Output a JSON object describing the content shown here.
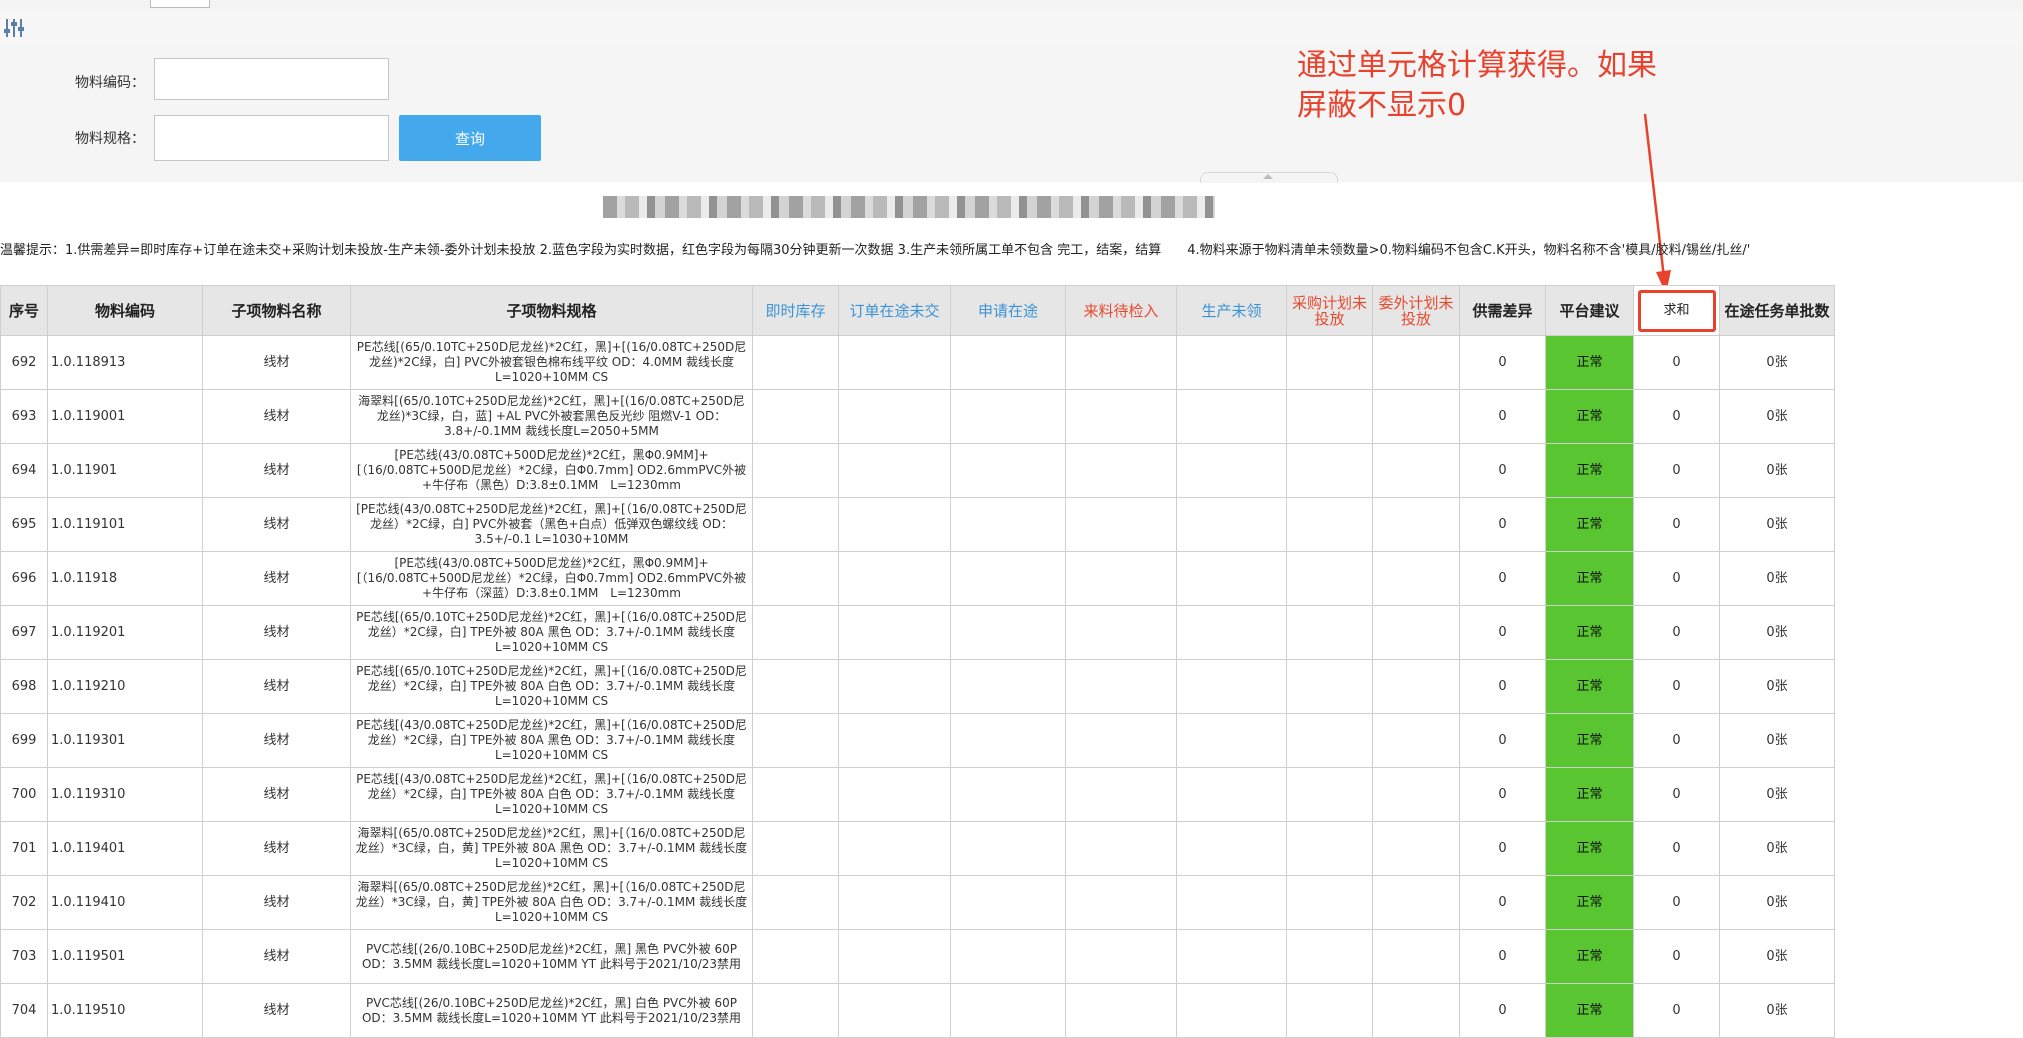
{
  "filter": {
    "code_label": "物料编码：",
    "spec_label": "物料规格：",
    "code_value": "",
    "spec_value": "",
    "query_button": "查询"
  },
  "annotation": {
    "line1": "通过单元格计算获得。如果",
    "line2": "屏蔽不显示0",
    "color": "#e8412c"
  },
  "tip": "温馨提示：1.供需差异=即时库存+订单在途未交+采购计划未投放-生产未领-委外计划未投放 2.蓝色字段为实时数据，红色字段为每隔30分钟更新一次数据 3.生产未领所属工单不包含 完工，结案，结算　　4.物料来源于物料清单未领数量>0.物料编码不包含C.K开头，物料名称不含'模具/胶料/锡丝/扎丝/'",
  "table": {
    "headers": {
      "seq": "序号",
      "code": "物料编码",
      "name": "子项物料名称",
      "spec": "子项物料规格",
      "stock": "即时库存",
      "order_transit": "订单在途未交",
      "apply_transit": "申请在途",
      "incoming": "来料待检入",
      "prod_unclaimed": "生产未领",
      "purchase_plan": "采购计划未投放",
      "outsource_plan": "委外计划未投放",
      "diff": "供需差异",
      "advice": "平台建议",
      "sum": "求和",
      "batches": "在途任务单批数"
    },
    "rows": [
      {
        "seq": "692",
        "code": "1.0.118913",
        "name": "线材",
        "spec": "PE芯线[(65/0.10TC+250D尼龙丝)*2C红，黑]+[(16/0.08TC+250D尼龙丝)*2C绿，白] PVC外被套银色棉布线平纹 OD：4.0MM 裁线长度L=1020+10MM CS",
        "diff": "0",
        "advice": "正常",
        "sum": "0",
        "batches": "0张"
      },
      {
        "seq": "693",
        "code": "1.0.119001",
        "name": "线材",
        "spec": "海翠料[(65/0.10TC+250D尼龙丝)*2C红，黑]+[(16/0.08TC+250D尼龙丝)*3C绿，白，蓝] +AL PVC外被套黑色反光纱 阻燃V-1 OD：3.8+/-0.1MM 裁线长度L=2050+5MM",
        "diff": "0",
        "advice": "正常",
        "sum": "0",
        "batches": "0张"
      },
      {
        "seq": "694",
        "code": "1.0.11901",
        "name": "线材",
        "spec": "[PE芯线(43/0.08TC+500D尼龙丝)*2C红，黑Φ0.9MM]+[（16/0.08TC+500D尼龙丝）*2C绿，白Φ0.7mm] OD2.6mmPVC外被+牛仔布（黑色）D:3.8±0.1MM　L=1230mm",
        "diff": "0",
        "advice": "正常",
        "sum": "0",
        "batches": "0张"
      },
      {
        "seq": "695",
        "code": "1.0.119101",
        "name": "线材",
        "spec": "[PE芯线(43/0.08TC+250D尼龙丝)*2C红，黑]+[（16/0.08TC+250D尼龙丝）*2C绿，白] PVC外被套（黑色+白点）低弹双色螺纹线 OD：3.5+/-0.1 L=1030+10MM",
        "diff": "0",
        "advice": "正常",
        "sum": "0",
        "batches": "0张"
      },
      {
        "seq": "696",
        "code": "1.0.11918",
        "name": "线材",
        "spec": "[PE芯线(43/0.08TC+500D尼龙丝)*2C红，黑Φ0.9MM]+[（16/0.08TC+500D尼龙丝）*2C绿，白Φ0.7mm] OD2.6mmPVC外被+牛仔布（深蓝）D:3.8±0.1MM　L=1230mm",
        "diff": "0",
        "advice": "正常",
        "sum": "0",
        "batches": "0张"
      },
      {
        "seq": "697",
        "code": "1.0.119201",
        "name": "线材",
        "spec": "PE芯线[(65/0.10TC+250D尼龙丝)*2C红，黑]+[（16/0.08TC+250D尼龙丝）*2C绿，白] TPE外被 80A 黑色 OD：3.7+/-0.1MM 裁线长度L=1020+10MM CS",
        "diff": "0",
        "advice": "正常",
        "sum": "0",
        "batches": "0张"
      },
      {
        "seq": "698",
        "code": "1.0.119210",
        "name": "线材",
        "spec": "PE芯线[(65/0.10TC+250D尼龙丝)*2C红，黑]+[（16/0.08TC+250D尼龙丝）*2C绿，白] TPE外被 80A 白色 OD：3.7+/-0.1MM 裁线长度L=1020+10MM CS",
        "diff": "0",
        "advice": "正常",
        "sum": "0",
        "batches": "0张"
      },
      {
        "seq": "699",
        "code": "1.0.119301",
        "name": "线材",
        "spec": "PE芯线[(43/0.08TC+250D尼龙丝)*2C红，黑]+[（16/0.08TC+250D尼龙丝）*2C绿，白] TPE外被 80A 黑色 OD：3.7+/-0.1MM 裁线长度L=1020+10MM CS",
        "diff": "0",
        "advice": "正常",
        "sum": "0",
        "batches": "0张"
      },
      {
        "seq": "700",
        "code": "1.0.119310",
        "name": "线材",
        "spec": "PE芯线[(43/0.08TC+250D尼龙丝)*2C红，黑]+[（16/0.08TC+250D尼龙丝）*2C绿，白] TPE外被 80A 白色 OD：3.7+/-0.1MM 裁线长度L=1020+10MM CS",
        "diff": "0",
        "advice": "正常",
        "sum": "0",
        "batches": "0张"
      },
      {
        "seq": "701",
        "code": "1.0.119401",
        "name": "线材",
        "spec": "海翠料[(65/0.08TC+250D尼龙丝)*2C红，黑]+[（16/0.08TC+250D尼龙丝）*3C绿，白，黄] TPE外被 80A 黑色 OD：3.7+/-0.1MM 裁线长度L=1020+10MM CS",
        "diff": "0",
        "advice": "正常",
        "sum": "0",
        "batches": "0张"
      },
      {
        "seq": "702",
        "code": "1.0.119410",
        "name": "线材",
        "spec": "海翠料[(65/0.08TC+250D尼龙丝)*2C红，黑]+[（16/0.08TC+250D尼龙丝）*3C绿，白，黄] TPE外被 80A 白色 OD：3.7+/-0.1MM 裁线长度L=1020+10MM CS",
        "diff": "0",
        "advice": "正常",
        "sum": "0",
        "batches": "0张"
      },
      {
        "seq": "703",
        "code": "1.0.119501",
        "name": "线材",
        "spec": "PVC芯线[(26/0.10BC+250D尼龙丝)*2C红，黑] 黑色 PVC外被 60P OD：3.5MM 裁线长度L=1020+10MM YT 此料号于2021/10/23禁用",
        "diff": "0",
        "advice": "正常",
        "sum": "0",
        "batches": "0张"
      },
      {
        "seq": "704",
        "code": "1.0.119510",
        "name": "线材",
        "spec": "PVC芯线[(26/0.10BC+250D尼龙丝)*2C红，黑] 白色 PVC外被 60P OD：3.5MM 裁线长度L=1020+10MM YT 此料号于2021/10/23禁用",
        "diff": "0",
        "advice": "正常",
        "sum": "0",
        "batches": "0张"
      }
    ]
  },
  "colors": {
    "accent_blue": "#44a8ec",
    "header_blue": "#3a93d6",
    "header_red": "#e64a2e",
    "status_green": "#58c531"
  }
}
